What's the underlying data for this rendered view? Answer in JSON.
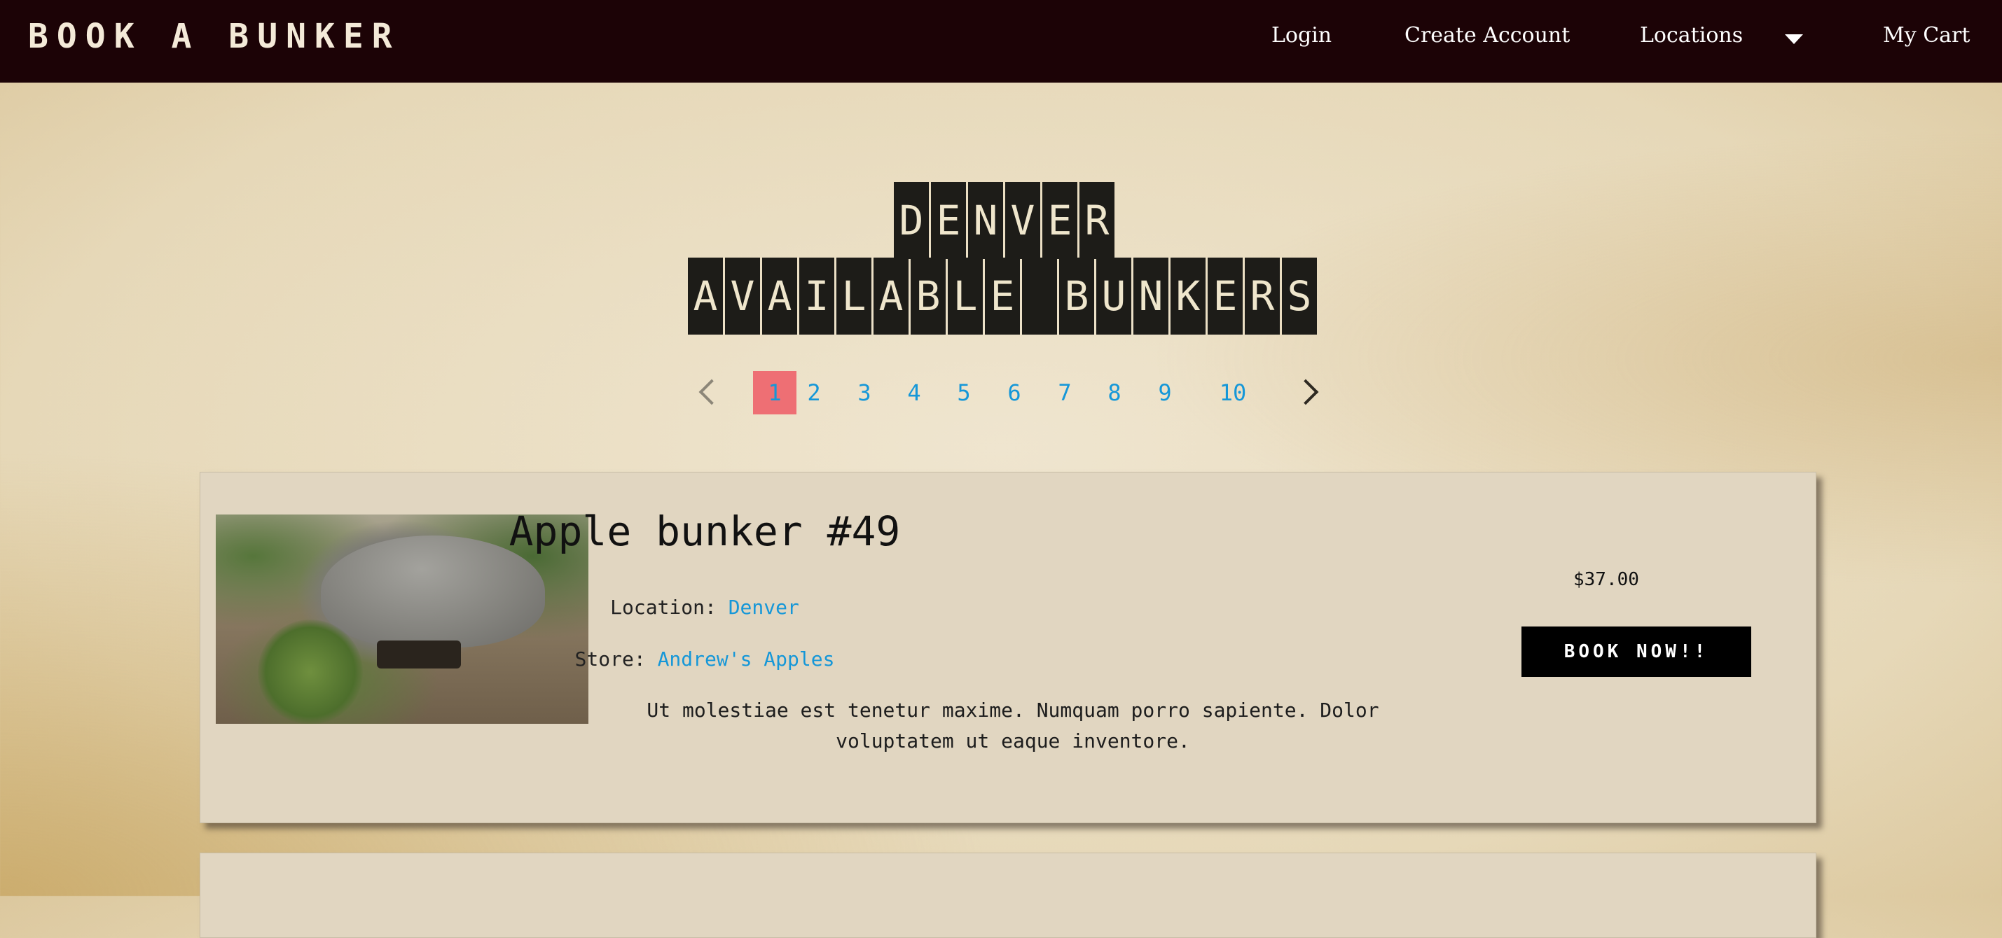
{
  "navbar": {
    "brand": "BOOK A BUNKER",
    "links": {
      "login": "Login",
      "create_account": "Create Account",
      "locations": "Locations",
      "cart": "My Cart"
    }
  },
  "heading": {
    "city": "DENVER",
    "subtitle": "AVAILABLE BUNKERS"
  },
  "pagination": {
    "pages": [
      "1",
      "2",
      "3",
      "4",
      "5",
      "6",
      "7",
      "8",
      "9",
      "10"
    ],
    "active_page": "1"
  },
  "listings": [
    {
      "title": "Apple bunker #49",
      "location_label": "Location:",
      "location_value": "Denver",
      "store_label": "Store:",
      "store_value": "Andrew's Apples",
      "description": "Ut molestiae est tenetur maxime. Numquam porro sapiente. Dolor voluptatem ut eaque inventore.",
      "price": "$37.00",
      "button_label": "BOOK NOW!!"
    }
  ],
  "colors": {
    "navbar_bg": "#1c0306",
    "link_blue": "#1597d8",
    "active_page_bg": "#ee6f74",
    "card_bg": "#e1d6c1",
    "button_bg": "#000000"
  },
  "icons": [
    "chevron-left-icon",
    "chevron-right-icon",
    "caret-down-icon"
  ]
}
